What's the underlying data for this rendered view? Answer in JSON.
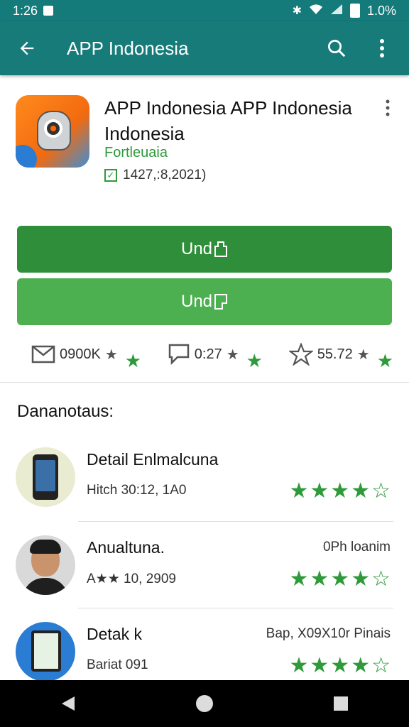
{
  "status_bar": {
    "time": "1:26",
    "battery": "1.0%"
  },
  "app_bar": {
    "title": "APP Indonesia"
  },
  "app": {
    "title": "APP Indonesia APP Indonesia Indonesia",
    "developer": "Fortleuaia",
    "meta": "1427,:8,2021)"
  },
  "buttons": {
    "primary": "Und",
    "secondary": "Und"
  },
  "stats": [
    {
      "value": "0900K"
    },
    {
      "value": "0:27"
    },
    {
      "value": "55.72"
    }
  ],
  "section": {
    "title": "Dananotaus:"
  },
  "list": [
    {
      "name": "Detail Enlmalcuna",
      "sub": "Hitch 30:12, 1A0",
      "right": "",
      "rating": "★★★★☆"
    },
    {
      "name": "Anualtuna.",
      "sub": "A★★ 10, 2909",
      "right": "0Ph loanim",
      "rating": "★★★★☆"
    },
    {
      "name": "Detak k",
      "sub": "Bariat  091",
      "right": "Bap, X09X10r Pinais",
      "rating": "★★★★☆"
    }
  ],
  "colors": {
    "app_bar": "#167b79",
    "status_bar": "#147a7a",
    "primary_button": "#2f8e3a",
    "secondary_button": "#4caf50",
    "accent_green": "#2e9a3a"
  }
}
